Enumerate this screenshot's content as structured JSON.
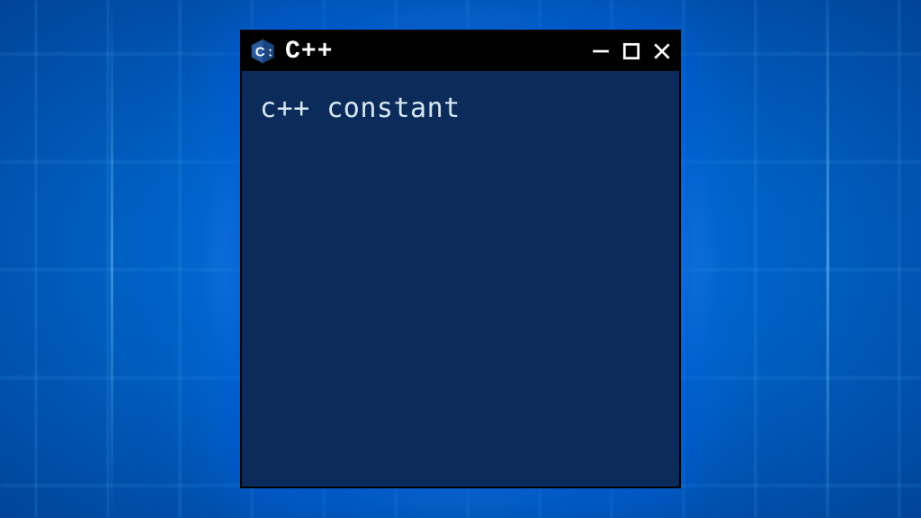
{
  "window": {
    "title": "C++",
    "logo_letter": "C",
    "content_text": "c++ constant"
  },
  "colors": {
    "window_bg": "#0b2b5b",
    "titlebar_bg": "#000000",
    "text": "#d8e8f5"
  }
}
